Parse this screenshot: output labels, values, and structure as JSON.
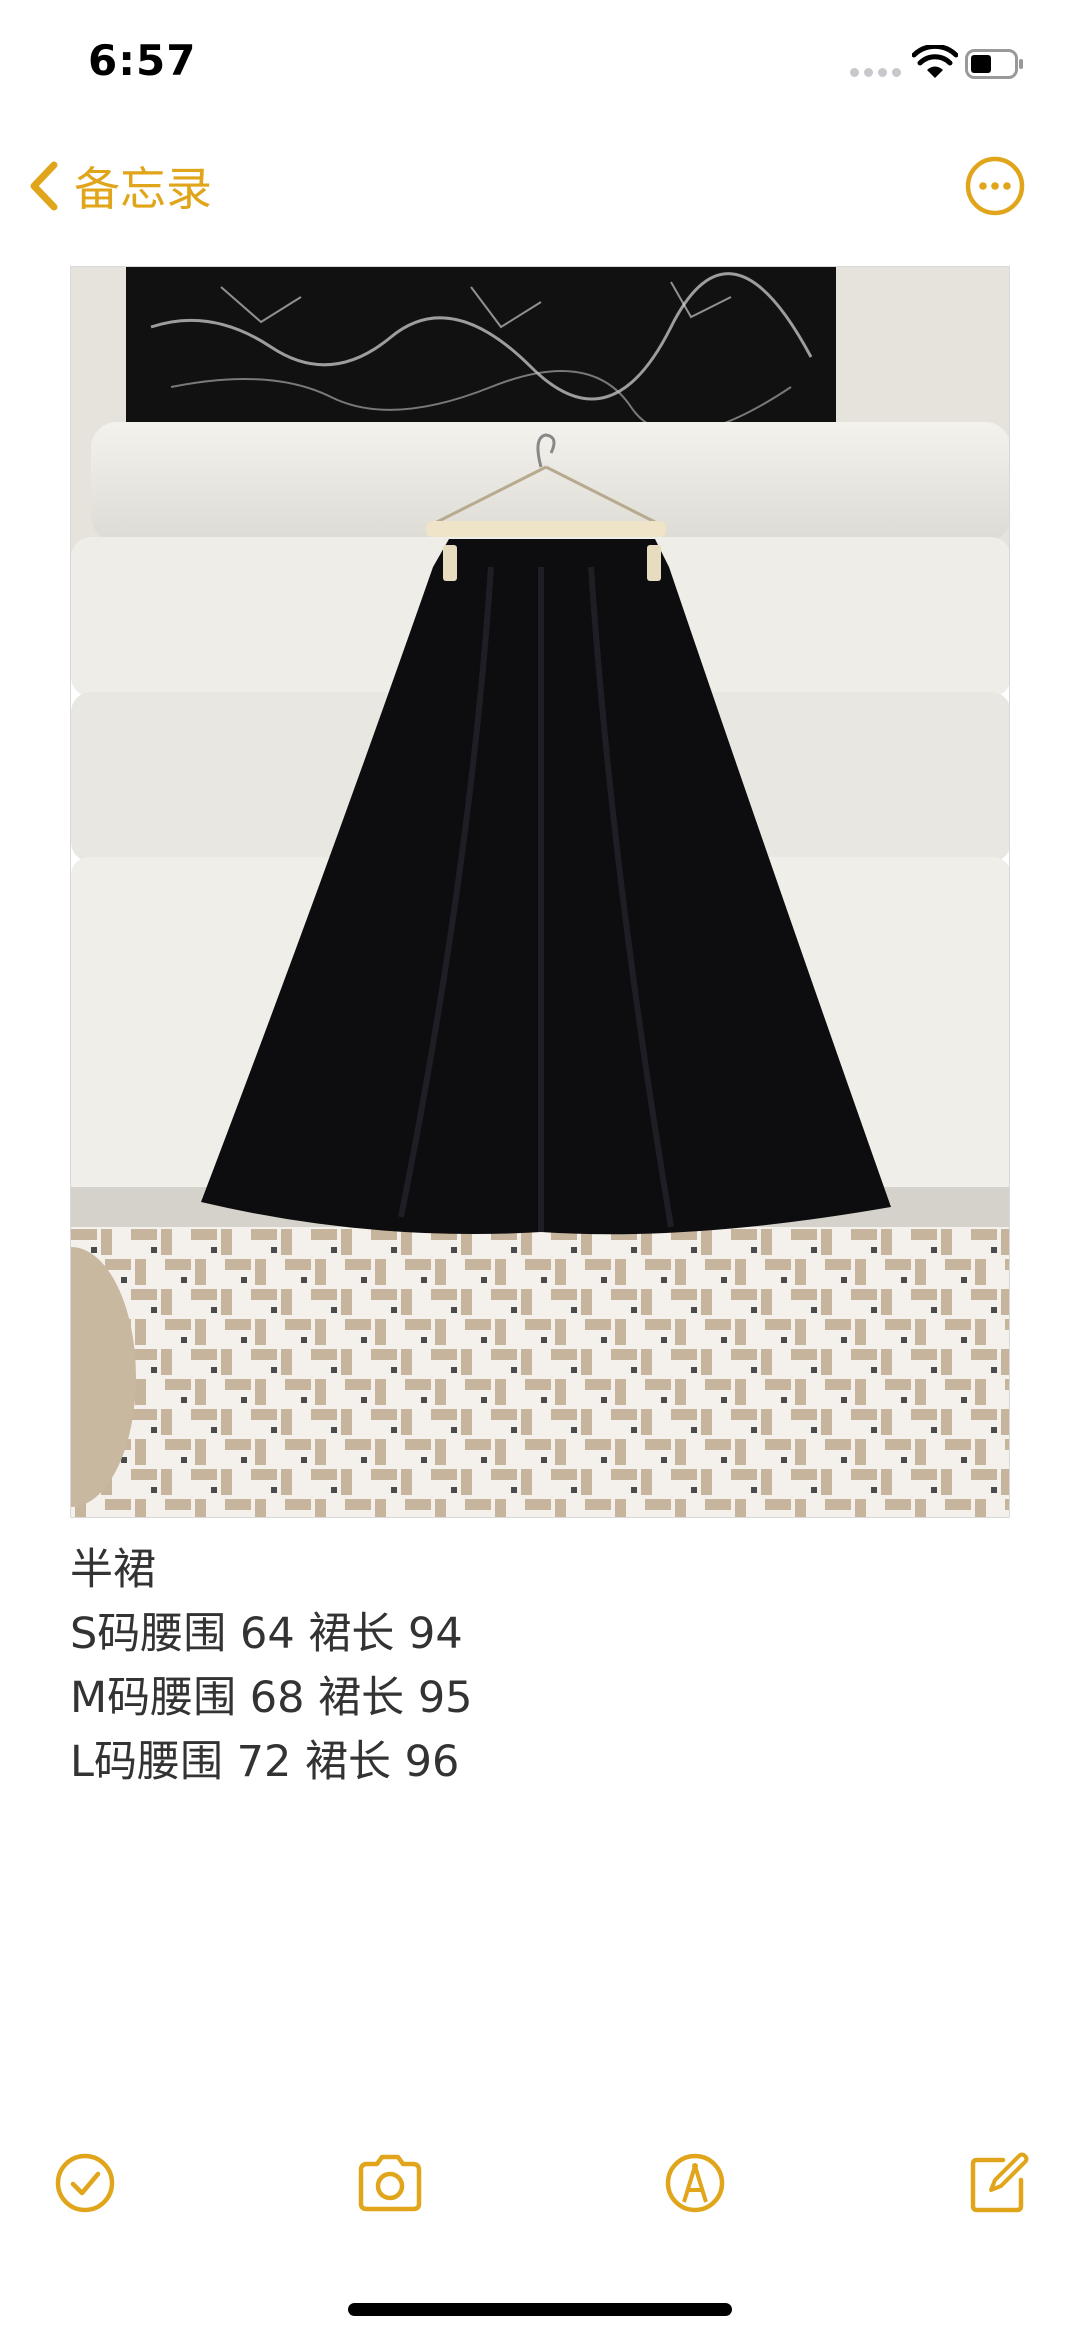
{
  "status_bar": {
    "time": "6:57"
  },
  "nav": {
    "back_label": "备忘录"
  },
  "photo": {
    "description_icon": "skirt-photo"
  },
  "note": {
    "lines": [
      "半裙",
      "S码腰围 64 裙长 94",
      "M码腰围 68 裙长 95",
      "L码腰围 72 裙长 96"
    ]
  },
  "toolbar": {
    "icons": [
      "checklist-icon",
      "camera-icon",
      "markup-icon",
      "compose-icon"
    ]
  },
  "colors": {
    "accent": "#e0a51a",
    "background": "#ffffff",
    "text": "#333333"
  }
}
